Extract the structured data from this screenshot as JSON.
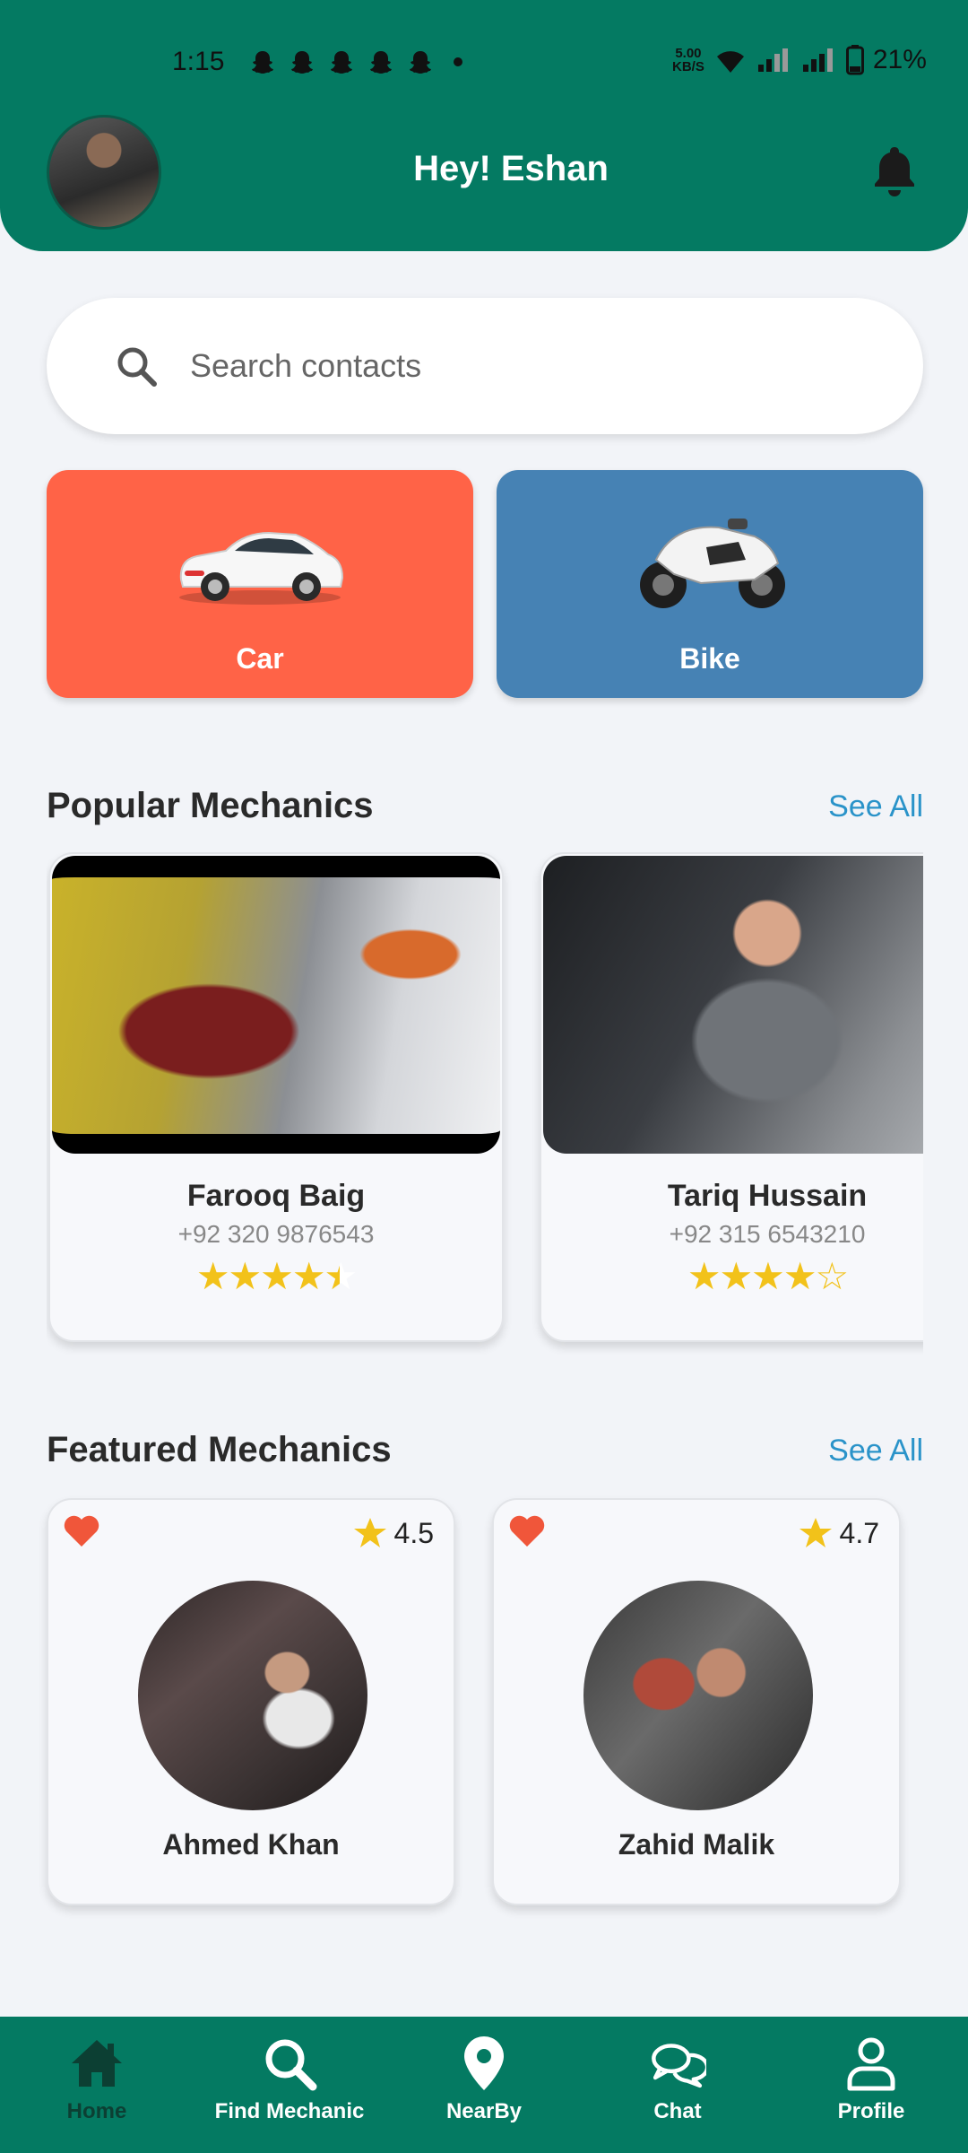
{
  "status_bar": {
    "time": "1:15",
    "net_speed_value": "5.00",
    "net_speed_unit": "KB/S",
    "battery": "21%"
  },
  "header": {
    "greeting": "Hey! Eshan",
    "background_color": "#047a62"
  },
  "search": {
    "placeholder": "Search contacts",
    "icon": "search-icon"
  },
  "categories": [
    {
      "label": "Car",
      "color": "#ff6347",
      "icon": "car-image"
    },
    {
      "label": "Bike",
      "color": "#4682b4",
      "icon": "bike-image"
    }
  ],
  "popular": {
    "title": "Popular Mechanics",
    "see_all": "See All",
    "cards": [
      {
        "name": "Farooq Baig",
        "phone": "+92 320 9876543",
        "rating": 4.5
      },
      {
        "name": "Tariq Hussain",
        "phone": "+92 315 6543210",
        "rating": 4
      }
    ]
  },
  "featured": {
    "title": "Featured Mechanics",
    "see_all": "See All",
    "cards": [
      {
        "name": "Ahmed Khan",
        "rating": "4.5",
        "favorite": true
      },
      {
        "name": "Zahid Malik",
        "rating": "4.7",
        "favorite": true
      }
    ]
  },
  "bottom_nav": {
    "active": "Home",
    "items": [
      {
        "label": "Home",
        "icon": "home-icon"
      },
      {
        "label": "Find Mechanic",
        "icon": "search-icon"
      },
      {
        "label": "NearBy",
        "icon": "location-pin-icon"
      },
      {
        "label": "Chat",
        "icon": "chat-icon"
      },
      {
        "label": "Profile",
        "icon": "profile-icon"
      }
    ]
  },
  "colors": {
    "primary": "#047a62",
    "accent_link": "#2a93c9",
    "star": "#f2c21a",
    "heart": "#f0563a"
  }
}
